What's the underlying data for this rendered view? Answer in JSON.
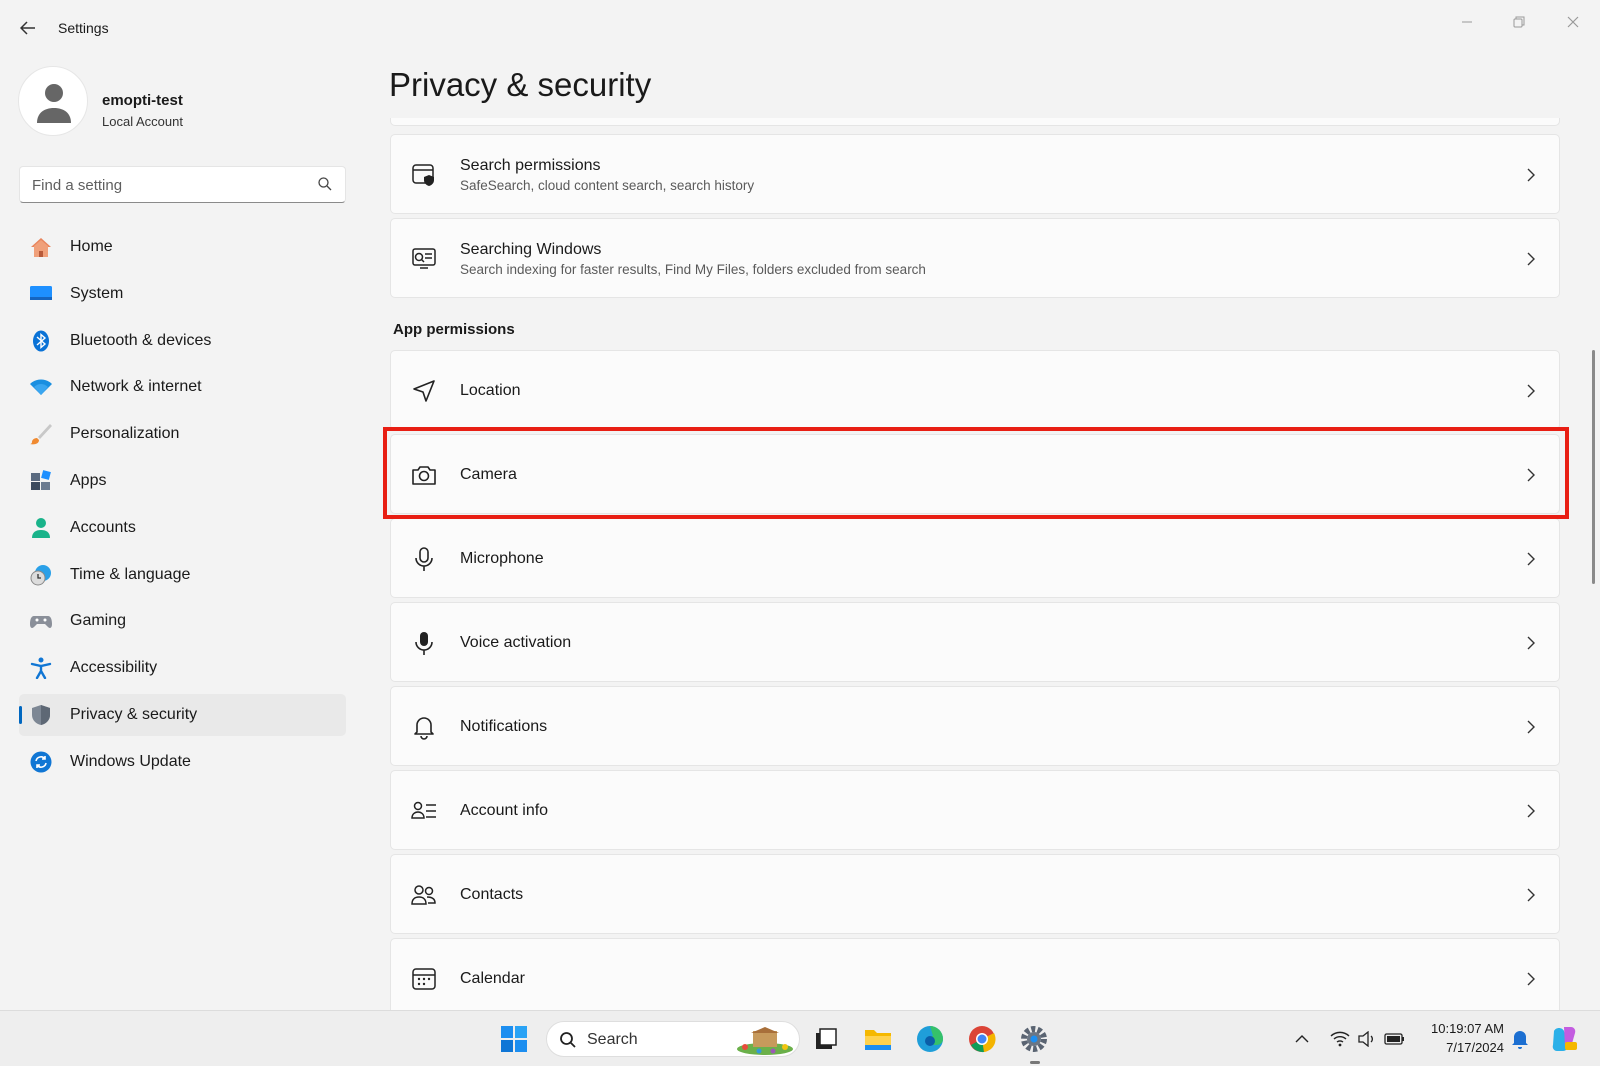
{
  "window": {
    "title": "Settings"
  },
  "profile": {
    "name": "emopti-test",
    "account_type": "Local Account"
  },
  "search": {
    "placeholder": "Find a setting"
  },
  "nav": {
    "items": [
      {
        "label": "Home",
        "icon": "home-icon"
      },
      {
        "label": "System",
        "icon": "system-icon"
      },
      {
        "label": "Bluetooth & devices",
        "icon": "bluetooth-icon"
      },
      {
        "label": "Network & internet",
        "icon": "wifi-icon"
      },
      {
        "label": "Personalization",
        "icon": "brush-icon"
      },
      {
        "label": "Apps",
        "icon": "apps-icon"
      },
      {
        "label": "Accounts",
        "icon": "accounts-icon"
      },
      {
        "label": "Time & language",
        "icon": "clock-globe-icon"
      },
      {
        "label": "Gaming",
        "icon": "gamepad-icon"
      },
      {
        "label": "Accessibility",
        "icon": "accessibility-icon"
      },
      {
        "label": "Privacy & security",
        "icon": "shield-icon",
        "selected": true
      },
      {
        "label": "Windows Update",
        "icon": "update-icon"
      }
    ]
  },
  "main": {
    "title": "Privacy & security",
    "search_section": [
      {
        "title": "Search permissions",
        "subtitle": "SafeSearch, cloud content search, search history",
        "icon": "search-permissions-icon"
      },
      {
        "title": "Searching Windows",
        "subtitle": "Search indexing for faster results, Find My Files, folders excluded from search",
        "icon": "searching-windows-icon"
      }
    ],
    "app_permissions_header": "App permissions",
    "app_permissions": [
      {
        "title": "Location",
        "icon": "location-icon"
      },
      {
        "title": "Camera",
        "icon": "camera-icon",
        "highlighted": true
      },
      {
        "title": "Microphone",
        "icon": "microphone-icon"
      },
      {
        "title": "Voice activation",
        "icon": "voice-activation-icon"
      },
      {
        "title": "Notifications",
        "icon": "bell-icon"
      },
      {
        "title": "Account info",
        "icon": "account-info-icon"
      },
      {
        "title": "Contacts",
        "icon": "contacts-icon"
      },
      {
        "title": "Calendar",
        "icon": "calendar-icon"
      }
    ]
  },
  "taskbar": {
    "search_label": "Search",
    "time": "10:19:07 AM",
    "date": "7/17/2024",
    "apps": [
      "windows-start-icon",
      "task-view-icon",
      "file-explorer-icon",
      "edge-icon",
      "chrome-icon",
      "settings-icon"
    ]
  },
  "colors": {
    "accent": "#0067c0",
    "highlight": "#e81e13"
  }
}
